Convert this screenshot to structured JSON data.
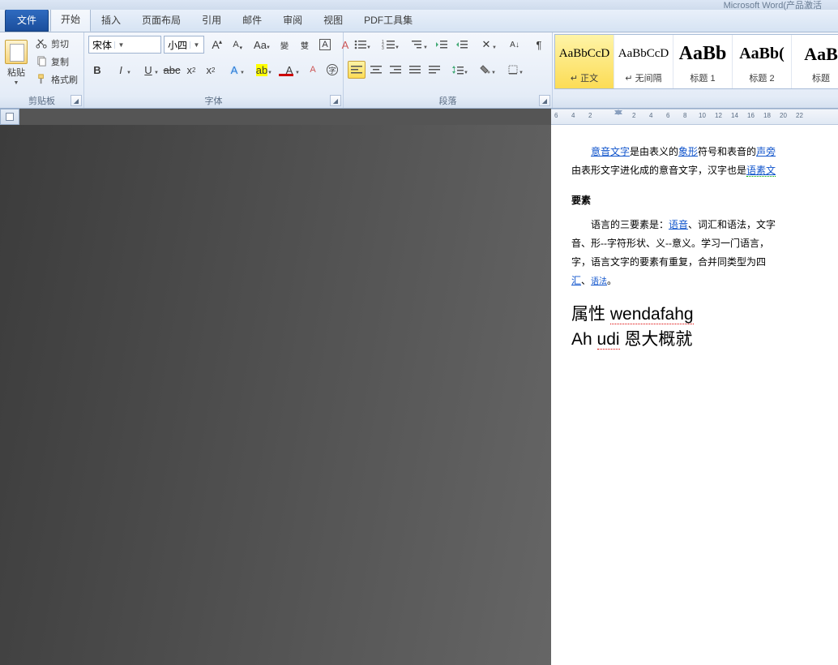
{
  "titlebar": {
    "app": "Microsoft Word(产品激活"
  },
  "tabs": {
    "file": "文件",
    "home": "开始",
    "insert": "插入",
    "layout": "页面布局",
    "ref": "引用",
    "mail": "邮件",
    "review": "审阅",
    "view": "视图",
    "pdf": "PDF工具集"
  },
  "clipboard": {
    "paste": "粘贴",
    "cut": "剪切",
    "copy": "复制",
    "painter": "格式刷",
    "label": "剪贴板"
  },
  "font": {
    "family": "宋体",
    "size": "小四",
    "label": "字体"
  },
  "paragraph": {
    "label": "段落"
  },
  "styles": {
    "items": [
      {
        "preview": "AaBbCcD",
        "name": "↵ 正文",
        "size": "15px",
        "sel": true
      },
      {
        "preview": "AaBbCcD",
        "name": "↵ 无间隔",
        "size": "15px"
      },
      {
        "preview": "AaBb",
        "name": "标题 1",
        "size": "24px",
        "bold": true
      },
      {
        "preview": "AaBb(",
        "name": "标题 2",
        "size": "20px",
        "bold": true
      },
      {
        "preview": "AaB",
        "name": "标题",
        "size": "22px",
        "bold": true
      }
    ]
  },
  "ruler": {
    "nums": [
      "6",
      "4",
      "2",
      "2",
      "4",
      "6",
      "8",
      "10",
      "12",
      "14",
      "16",
      "18",
      "20",
      "22"
    ]
  },
  "doc": {
    "p1_link1": "意音文字",
    "p1_a": "是由表义的",
    "p1_link2": "象形",
    "p1_b": "符号和表音的",
    "p1_link3": "声旁",
    "p2_a": "由表形文字进化成的意音文字，汉字也是",
    "p2_link": "语素文",
    "h1": "要素",
    "p3_a": "语言的三要素是：",
    "p3_link": "语音",
    "p3_b": "、词汇和语法，文字",
    "p4": "音、形--字符形状、义--意义。学习一门语言，",
    "p5": "字，语言文字的要素有重复，合并同类型为四",
    "p6_link1": "汇",
    "p6_sep": "、",
    "p6_link2": "语法",
    "p6_end": "。",
    "big1a": "属性 ",
    "big1b": "wendafahg",
    "big2a": "Ah ",
    "big2b": "udi",
    "big2c": " 恩大概就"
  }
}
